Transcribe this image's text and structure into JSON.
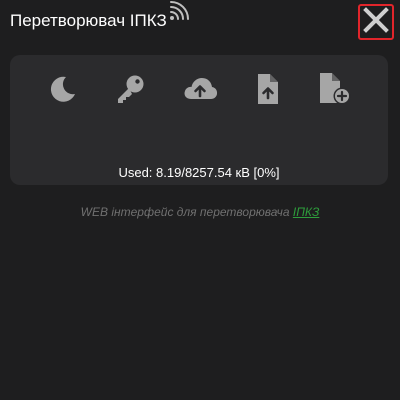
{
  "header": {
    "title": "Перетворювач ІПКЗ",
    "signal_icon": "wifi-signal-icon",
    "close_icon": "close-icon",
    "close_border_color": "#e2252b"
  },
  "toolbar": {
    "icon_color": "#a6a6a6",
    "items": [
      {
        "icon": "moon-icon"
      },
      {
        "icon": "key-icon"
      },
      {
        "icon": "cloud-upload-icon"
      },
      {
        "icon": "file-upload-icon"
      },
      {
        "icon": "file-add-icon"
      }
    ]
  },
  "storage": {
    "used_text": "Used: 8.19/8257.54 кВ [0%]"
  },
  "footer": {
    "text": "WEB інтерфейс для перетворювача ",
    "link_text": "ІПКЗ",
    "link_color": "#2e9e3c"
  }
}
